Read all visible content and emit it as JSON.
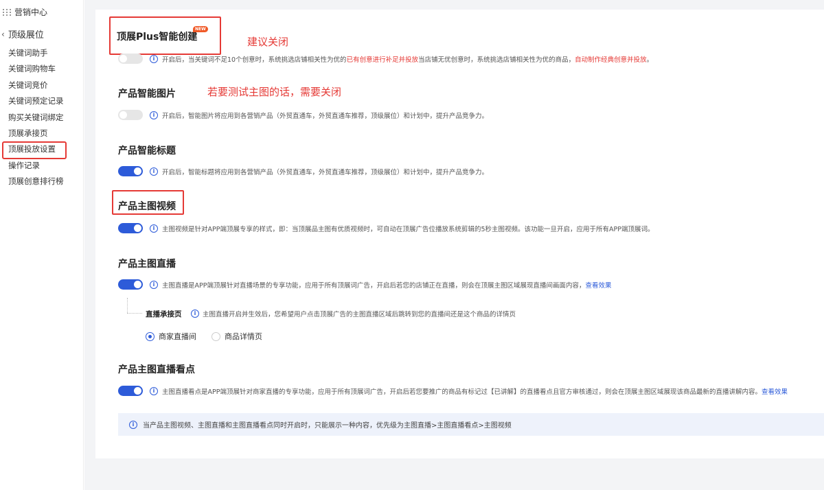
{
  "sidebar": {
    "brand": "营销中心",
    "parent": "顶级展位",
    "items": [
      {
        "label": "关键词助手"
      },
      {
        "label": "关键词购物车"
      },
      {
        "label": "关键词竞价"
      },
      {
        "label": "关键词预定记录"
      },
      {
        "label": "购买关键词绑定"
      },
      {
        "label": "顶展承接页"
      },
      {
        "label": "顶展投放设置"
      },
      {
        "label": "操作记录"
      },
      {
        "label": "顶展创意排行榜"
      }
    ],
    "active_index": 6
  },
  "sections": {
    "plus": {
      "title": "顶展Plus智能创建",
      "badge": "NEW",
      "toggle": "off",
      "desc_1": "开启后，当关键词不足10个创意时，系统挑选店铺相关性为优的",
      "desc_red_1": "已有创意进行补足并投放",
      "desc_2": "当店铺无优创意时，系统挑选店铺相关性为优的商品，",
      "desc_red_2": "自动制作经典创意并投放",
      "desc_3": "。"
    },
    "image": {
      "title": "产品智能图片",
      "toggle": "off",
      "desc": "开启后，智能图片将应用到各营销产品（外贸直通车，外贸直通车推荐，顶级展位）和计划中，提升产品竞争力。"
    },
    "smart_title": {
      "title": "产品智能标题",
      "toggle": "on",
      "desc": "开启后，智能标题将应用到各营销产品（外贸直通车，外贸直通车推荐，顶级展位）和计划中，提升产品竞争力。"
    },
    "video": {
      "title": "产品主图视频",
      "toggle": "on",
      "desc": "主图视频是针对APP端顶展专享的样式，即：当顶展品主图有优质视频时，可自动在顶展广告位播放系统剪辑的5秒主图视频。该功能一旦开启，应用于所有APP端顶展词。"
    },
    "live": {
      "title": "产品主图直播",
      "toggle": "on",
      "desc": "主图直播是APP端顶展针对直播场景的专享功能，应用于所有顶展词广告，开启后若您的店铺正在直播，则会在顶展主图区域展现直播间画面内容，",
      "link": "查看效果",
      "sub_label": "直播承接页",
      "sub_desc": "主图直播开启并生效后，您希望用户点击顶展广告的主图直播区域后跳转到您的直播间还是这个商品的详情页",
      "radio_options": [
        {
          "label": "商家直播间",
          "checked": true
        },
        {
          "label": "商品详情页",
          "checked": false
        }
      ]
    },
    "highlight": {
      "title": "产品主图直播看点",
      "toggle": "on",
      "desc": "主图直播看点是APP端顶展针对商家直播的专享功能，应用于所有顶展词广告，开启后若您要推广的商品有标记过【已讲解】的直播看点且官方审核通过，则会在顶展主图区域展现该商品最新的直播讲解内容。",
      "link": "查看效果"
    }
  },
  "notice": "当产品主图视频、主图直播和主图直播看点同时开启时，只能展示一种内容，优先级为主图直播>主图直播看点>主图视频",
  "annotations": {
    "plus": "建议关闭",
    "image": "若要测试主图的话，需要关闭"
  },
  "colors": {
    "accent": "#2d5bd9",
    "annotation_red": "#e53935",
    "badge": "#f05a28"
  }
}
